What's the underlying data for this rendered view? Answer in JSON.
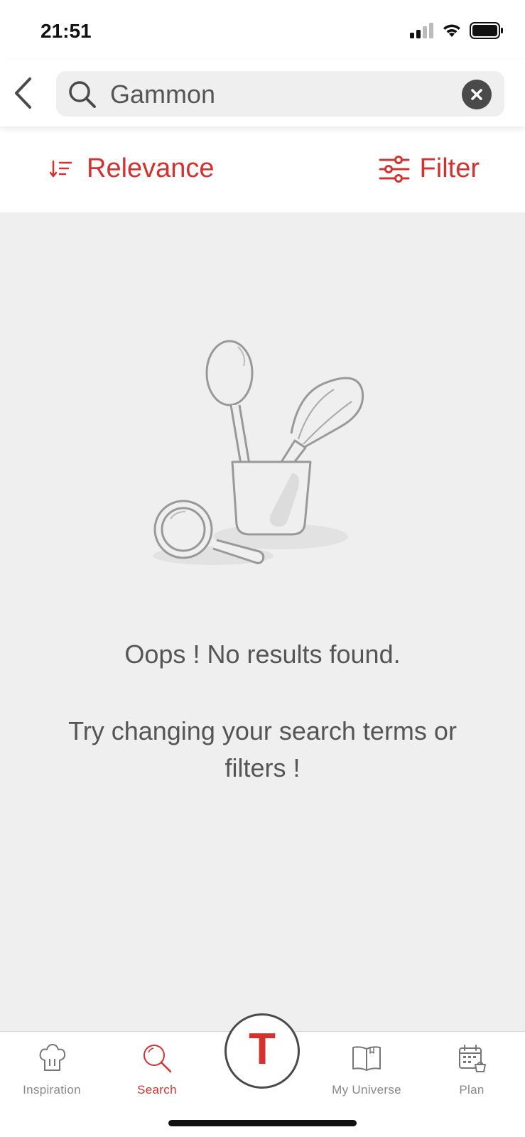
{
  "status_bar": {
    "time": "21:51"
  },
  "search": {
    "query": "Gammon"
  },
  "sort": {
    "label": "Relevance"
  },
  "filter": {
    "label": "Filter"
  },
  "empty_state": {
    "title": "Oops ! No results found.",
    "subtitle": "Try changing your search terms or filters !"
  },
  "tab_bar": {
    "items": [
      {
        "label": "Inspiration",
        "icon": "chef-hat-icon"
      },
      {
        "label": "Search",
        "icon": "search-icon",
        "active": true
      },
      {
        "label": "My Universe",
        "icon": "book-icon"
      },
      {
        "label": "Plan",
        "icon": "calendar-icon"
      }
    ],
    "center_button": "T"
  },
  "colors": {
    "accent": "#d3322e",
    "text": "#555555",
    "background": "#efefef"
  }
}
